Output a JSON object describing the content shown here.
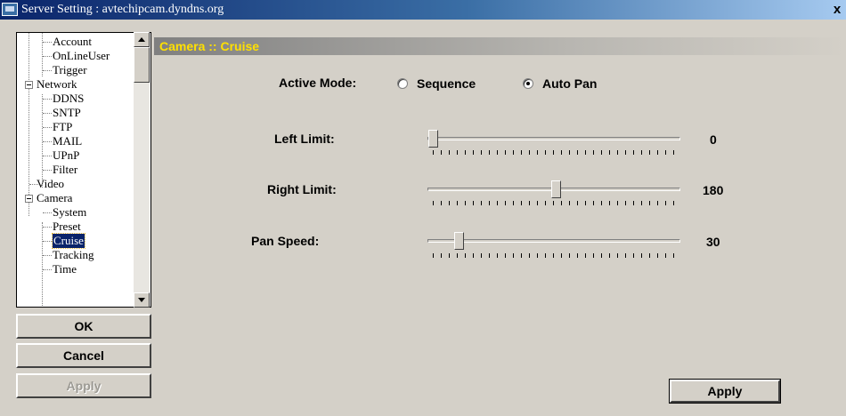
{
  "window": {
    "title": "Server Setting : avtechipcam.dyndns.org",
    "close_label": "x"
  },
  "tree": {
    "items": [
      {
        "label": "Account"
      },
      {
        "label": "OnLineUser"
      },
      {
        "label": "Trigger"
      },
      {
        "label": "Network"
      },
      {
        "label": "DDNS"
      },
      {
        "label": "SNTP"
      },
      {
        "label": "FTP"
      },
      {
        "label": "MAIL"
      },
      {
        "label": "UPnP"
      },
      {
        "label": "Filter"
      },
      {
        "label": "Video"
      },
      {
        "label": "Camera"
      },
      {
        "label": "System"
      },
      {
        "label": "Preset"
      },
      {
        "label": "Cruise"
      },
      {
        "label": "Tracking"
      },
      {
        "label": "Time"
      }
    ]
  },
  "buttons": {
    "ok": "OK",
    "cancel": "Cancel",
    "apply_left": "Apply",
    "apply_right": "Apply"
  },
  "panel": {
    "header": "Camera :: Cruise",
    "active_mode_label": "Active Mode:",
    "mode_sequence": "Sequence",
    "mode_auto_pan": "Auto Pan",
    "selected_mode": "Auto Pan",
    "left_limit_label": "Left Limit:",
    "left_limit_value": "0",
    "right_limit_label": "Right Limit:",
    "right_limit_value": "180",
    "pan_speed_label": "Pan Speed:",
    "pan_speed_value": "30"
  }
}
